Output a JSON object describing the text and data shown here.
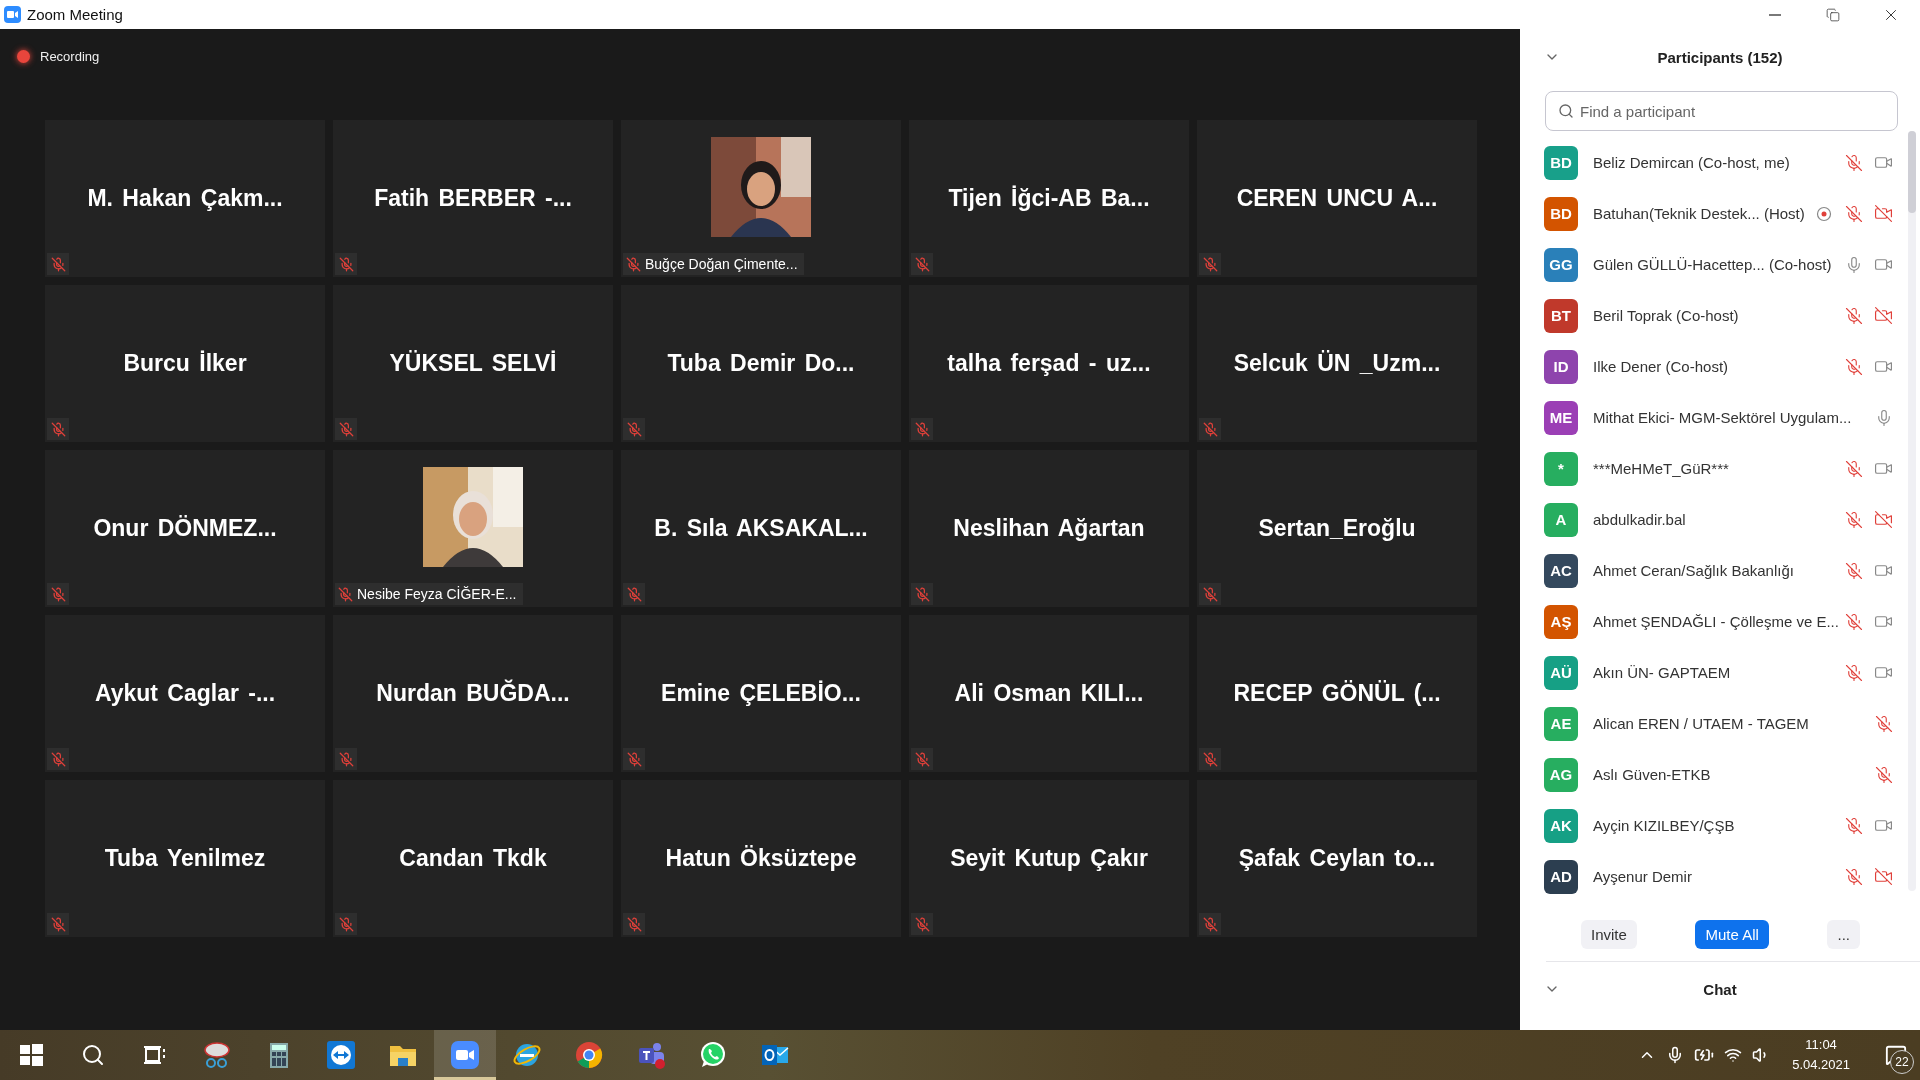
{
  "window": {
    "title": "Zoom Meeting"
  },
  "recording_label": "Recording",
  "tiles": [
    {
      "kind": "name",
      "name": "M. Hakan Çakm...",
      "muted": true
    },
    {
      "kind": "name",
      "name": "Fatih BERBER -...",
      "muted": true
    },
    {
      "name": "Buğçe Doğan Çimente...",
      "muted": true
    },
    {
      "kind": "name",
      "name": "Tijen İğci-AB Ba...",
      "muted": true
    },
    {
      "kind": "name",
      "name": "CEREN UNCU A...",
      "muted": true
    },
    {
      "kind": "name",
      "name": "Burcu İlker",
      "muted": true
    },
    {
      "kind": "name",
      "name": "YÜKSEL SELVİ",
      "muted": true
    },
    {
      "kind": "name",
      "name": "Tuba Demir Do...",
      "muted": true
    },
    {
      "kind": "name",
      "name": "talha ferşad - uz...",
      "muted": true
    },
    {
      "kind": "name",
      "name": "Selcuk ÜN _Uzm...",
      "muted": true
    },
    {
      "kind": "name",
      "name": "Onur DÖNMEZ...",
      "muted": true
    },
    {
      "name": "Nesibe Feyza CİĞER-E...",
      "muted": true
    },
    {
      "kind": "name",
      "name": "B. Sıla AKSAKAL...",
      "muted": true
    },
    {
      "kind": "name",
      "name": "Neslihan Ağartan",
      "muted": true
    },
    {
      "kind": "name",
      "name": "Sertan_Eroğlu",
      "muted": true
    },
    {
      "kind": "name",
      "name": "Aykut Caglar -...",
      "muted": true
    },
    {
      "kind": "name",
      "name": "Nurdan BUĞDA...",
      "muted": true
    },
    {
      "kind": "name",
      "name": "Emine ÇELEBİO...",
      "muted": true
    },
    {
      "kind": "name",
      "name": "Ali Osman KILI...",
      "muted": true
    },
    {
      "kind": "name",
      "name": "RECEP GÖNÜL (...",
      "muted": true
    },
    {
      "kind": "name",
      "name": "Tuba Yenilmez",
      "muted": true
    },
    {
      "kind": "name",
      "name": "Candan Tkdk",
      "muted": true
    },
    {
      "kind": "name",
      "name": "Hatun Öksüztepe",
      "muted": true
    },
    {
      "kind": "name",
      "name": "Seyit Kutup Çakır",
      "muted": true
    },
    {
      "kind": "name",
      "name": "Şafak Ceylan to...",
      "muted": true
    }
  ],
  "participants": {
    "title": "Participants (152)",
    "search": {
      "placeholder": "Find a participant"
    },
    "items": [
      {
        "initials": "BD",
        "color": "#18a08a",
        "name": "Beliz Demircan (Co-host, me)",
        "recording": false,
        "mic_muted": true,
        "camera": {
          "off": false
        }
      },
      {
        "initials": "BD",
        "color": "#d35400",
        "name": "Batuhan(Teknik Destek... (Host)",
        "recording": true,
        "mic_muted": true,
        "camera": {
          "off": true
        }
      },
      {
        "initials": "GG",
        "color": "#2a80b9",
        "name": "Gülen GÜLLÜ-Hacettep... (Co-host)",
        "recording": false,
        "mic_muted": false,
        "camera": {
          "off": false
        }
      },
      {
        "initials": "BT",
        "color": "#c0392b",
        "name": "Beril Toprak (Co-host)",
        "recording": false,
        "mic_muted": true,
        "camera": {
          "off": true
        }
      },
      {
        "initials": "ID",
        "color": "#8e44ad",
        "name": "Ilke Dener (Co-host)",
        "recording": false,
        "mic_muted": true,
        "camera": {
          "off": false
        }
      },
      {
        "initials": "ME",
        "color": "#9b3fb5",
        "name": "Mithat Ekici- MGM-Sektörel Uygulam...",
        "recording": false,
        "mic_muted": false
      },
      {
        "initials": "*",
        "color": "#27ae60",
        "name": "***MeHMeT_GüR***",
        "recording": false,
        "mic_muted": true,
        "camera": {
          "off": false
        }
      },
      {
        "initials": "A",
        "color": "#27ae60",
        "name": "abdulkadir.bal",
        "recording": false,
        "mic_muted": true,
        "camera": {
          "off": true
        }
      },
      {
        "initials": "AC",
        "color": "#34495e",
        "name": "Ahmet Ceran/Sağlık Bakanlığı",
        "recording": false,
        "mic_muted": true,
        "camera": {
          "off": false
        }
      },
      {
        "initials": "AŞ",
        "color": "#d35400",
        "name": "Ahmet ŞENDAĞLI - Çölleşme ve E...",
        "recording": false,
        "mic_muted": true,
        "camera": {
          "off": false
        }
      },
      {
        "initials": "AÜ",
        "color": "#16a085",
        "name": "Akın ÜN- GAPTAEM",
        "recording": false,
        "mic_muted": true,
        "camera": {
          "off": false
        }
      },
      {
        "initials": "AE",
        "color": "#27ae60",
        "name": "Alican EREN / UTAEM - TAGEM",
        "recording": false,
        "mic_muted": true
      },
      {
        "initials": "AG",
        "color": "#27ae60",
        "name": "Aslı Güven-ETKB",
        "recording": false,
        "mic_muted": true
      },
      {
        "initials": "AK",
        "color": "#16a085",
        "name": "Ayçin KIZILBEY/ÇŞB",
        "recording": false,
        "mic_muted": true,
        "camera": {
          "off": false
        }
      },
      {
        "initials": "AD",
        "color": "#2c3e50",
        "name": "Ayşenur Demir",
        "recording": false,
        "mic_muted": true,
        "camera": {
          "off": true
        }
      }
    ],
    "buttons": [
      {
        "label": "Invite",
        "kind": "plain"
      },
      {
        "label": "Mute All",
        "kind": "primary"
      },
      {
        "label": "...",
        "kind": "plain"
      }
    ]
  },
  "chat": {
    "title": "Chat"
  },
  "taskbar": {
    "apps": [
      {
        "kind": "start",
        "active": false
      },
      {
        "kind": "search",
        "active": false
      },
      {
        "kind": "taskview",
        "active": false
      },
      {
        "kind": "snip",
        "active": false
      },
      {
        "kind": "calc",
        "active": false
      },
      {
        "kind": "remote",
        "active": false
      },
      {
        "kind": "folder",
        "active": false
      },
      {
        "kind": "zoom",
        "active": true
      },
      {
        "kind": "ie",
        "active": false
      },
      {
        "kind": "chrome",
        "active": false
      },
      {
        "kind": "teams",
        "active": false
      },
      {
        "kind": "whatsapp",
        "active": false
      },
      {
        "kind": "outlook",
        "active": false
      }
    ],
    "time": "11:04",
    "date": "5.04.2021",
    "notifications": "22"
  }
}
